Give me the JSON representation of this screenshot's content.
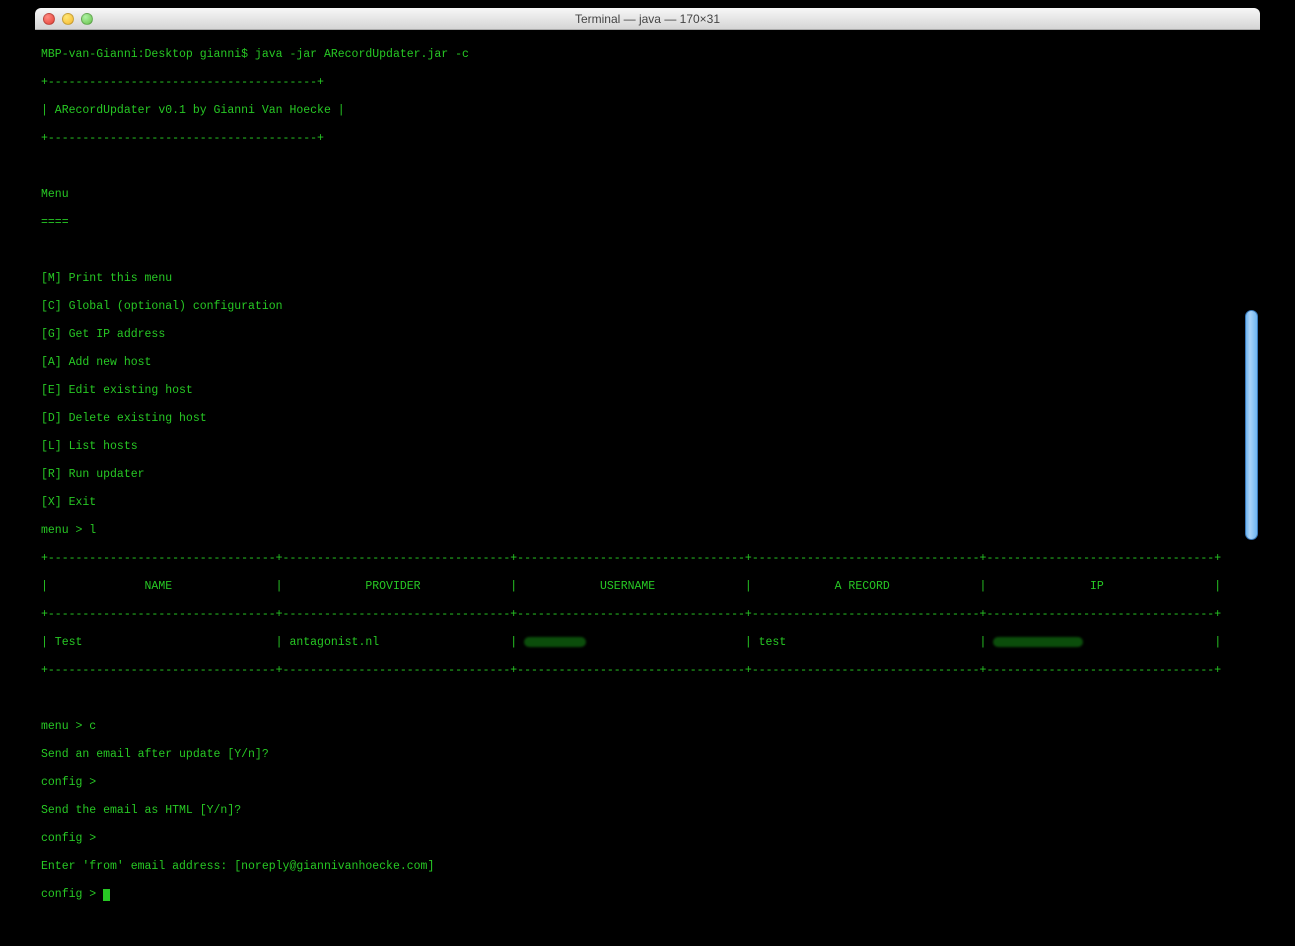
{
  "window": {
    "title": "Terminal — java — 170×31"
  },
  "prompt_line": "MBP-van-Gianni:Desktop gianni$ java -jar ARecordUpdater.jar -c",
  "header": {
    "border_top": "+---------------------------------------+",
    "title": "| ARecordUpdater v0.1 by Gianni Van Hoecke |",
    "border_bot": "+---------------------------------------+"
  },
  "menu_title": "Menu",
  "menu_underline": "====",
  "menu_items": [
    "[M] Print this menu",
    "[C] Global (optional) configuration",
    "[G] Get IP address",
    "[A] Add new host",
    "[E] Edit existing host",
    "[D] Delete existing host",
    "[L] List hosts",
    "[R] Run updater",
    "[X] Exit"
  ],
  "menu_prompt1": "menu > l",
  "table": {
    "border": "+------------------------+------------------------+------------------------+------------------------+------------------------+",
    "headers": [
      "NAME",
      "PROVIDER",
      "USERNAME",
      "A RECORD",
      "IP"
    ],
    "row": {
      "name": "Test",
      "provider": "antagonist.nl",
      "username_redacted": true,
      "a_record": "test",
      "ip_redacted": true
    }
  },
  "menu_prompt2": "menu > c",
  "config": {
    "q1": "Send an email after update [Y/n]?",
    "p1": "config > ",
    "q2": "Send the email as HTML [Y/n]?",
    "p2": "config > ",
    "q3": "Enter 'from' email address: [noreply@giannivanhoecke.com]",
    "p3": "config > "
  }
}
